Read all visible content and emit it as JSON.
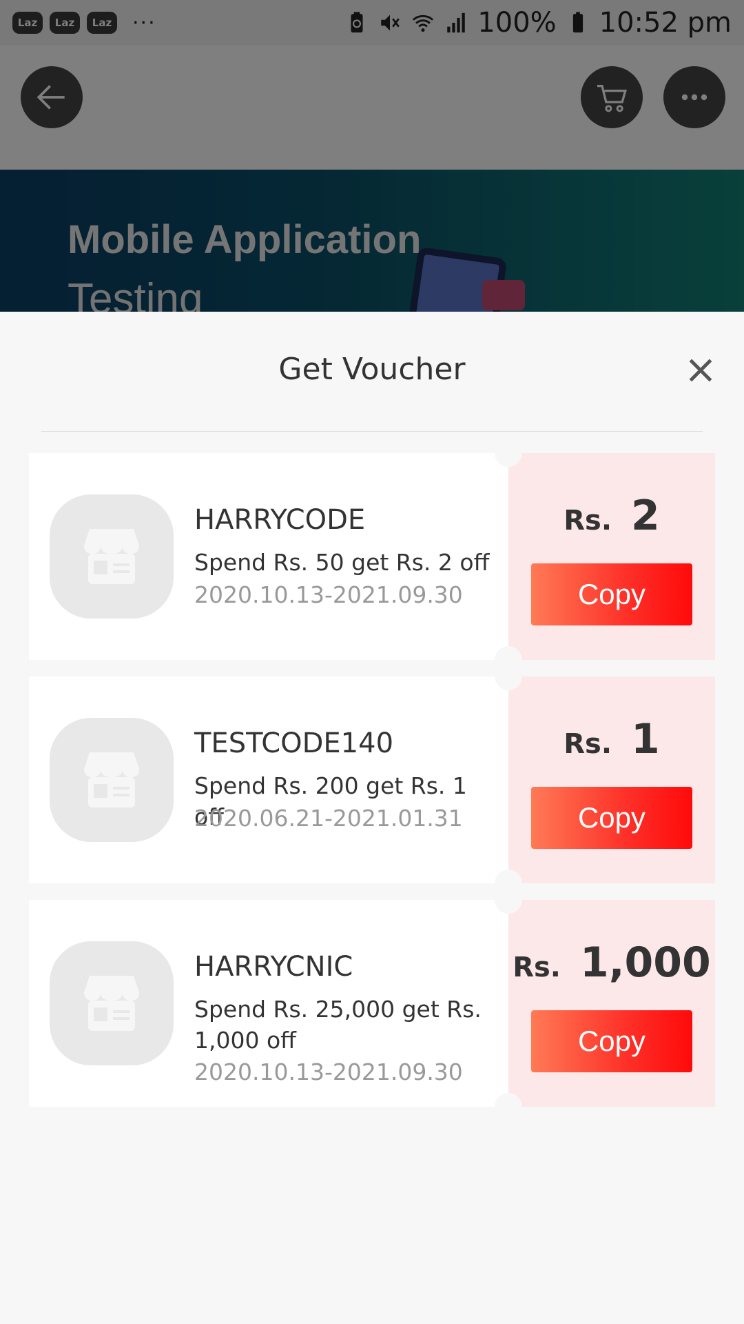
{
  "status_bar": {
    "app_badges": [
      "Laz",
      "Laz",
      "Laz"
    ],
    "more": "···",
    "battery_percent": "100%",
    "time": "10:52 pm",
    "icons": [
      "battery-saver-icon",
      "mute-icon",
      "wifi-icon",
      "signal-icon",
      "battery-icon"
    ]
  },
  "nav": {
    "back_icon": "back-arrow-icon",
    "cart_icon": "cart-icon",
    "more_icon": "more-icon"
  },
  "banner": {
    "title": "Mobile Application",
    "subtitle": "Testing"
  },
  "sheet": {
    "title": "Get Voucher",
    "close_icon": "close-icon"
  },
  "vouchers": [
    {
      "code": "HARRYCODE",
      "description": "Spend Rs. 50 get Rs. 2 off",
      "validity": "2020.10.13-2021.09.30",
      "currency": "Rs.",
      "amount": "2",
      "button": "Copy"
    },
    {
      "code": "TESTCODE140",
      "description": "Spend Rs. 200 get Rs. 1 off",
      "validity": "2020.06.21-2021.01.31",
      "currency": "Rs.",
      "amount": "1",
      "button": "Copy"
    },
    {
      "code": "HARRYCNIC",
      "description": "Spend Rs. 25,000 get Rs. 1,000 off",
      "validity": "2020.10.13-2021.09.30",
      "currency": "Rs.",
      "amount": "1,000",
      "button": "Copy"
    }
  ],
  "colors": {
    "copy_button_start": "#ff7a55",
    "copy_button_end": "#ff0a0a",
    "amount_panel_bg": "#fde8e9",
    "sheet_bg": "#f7f7f7"
  }
}
